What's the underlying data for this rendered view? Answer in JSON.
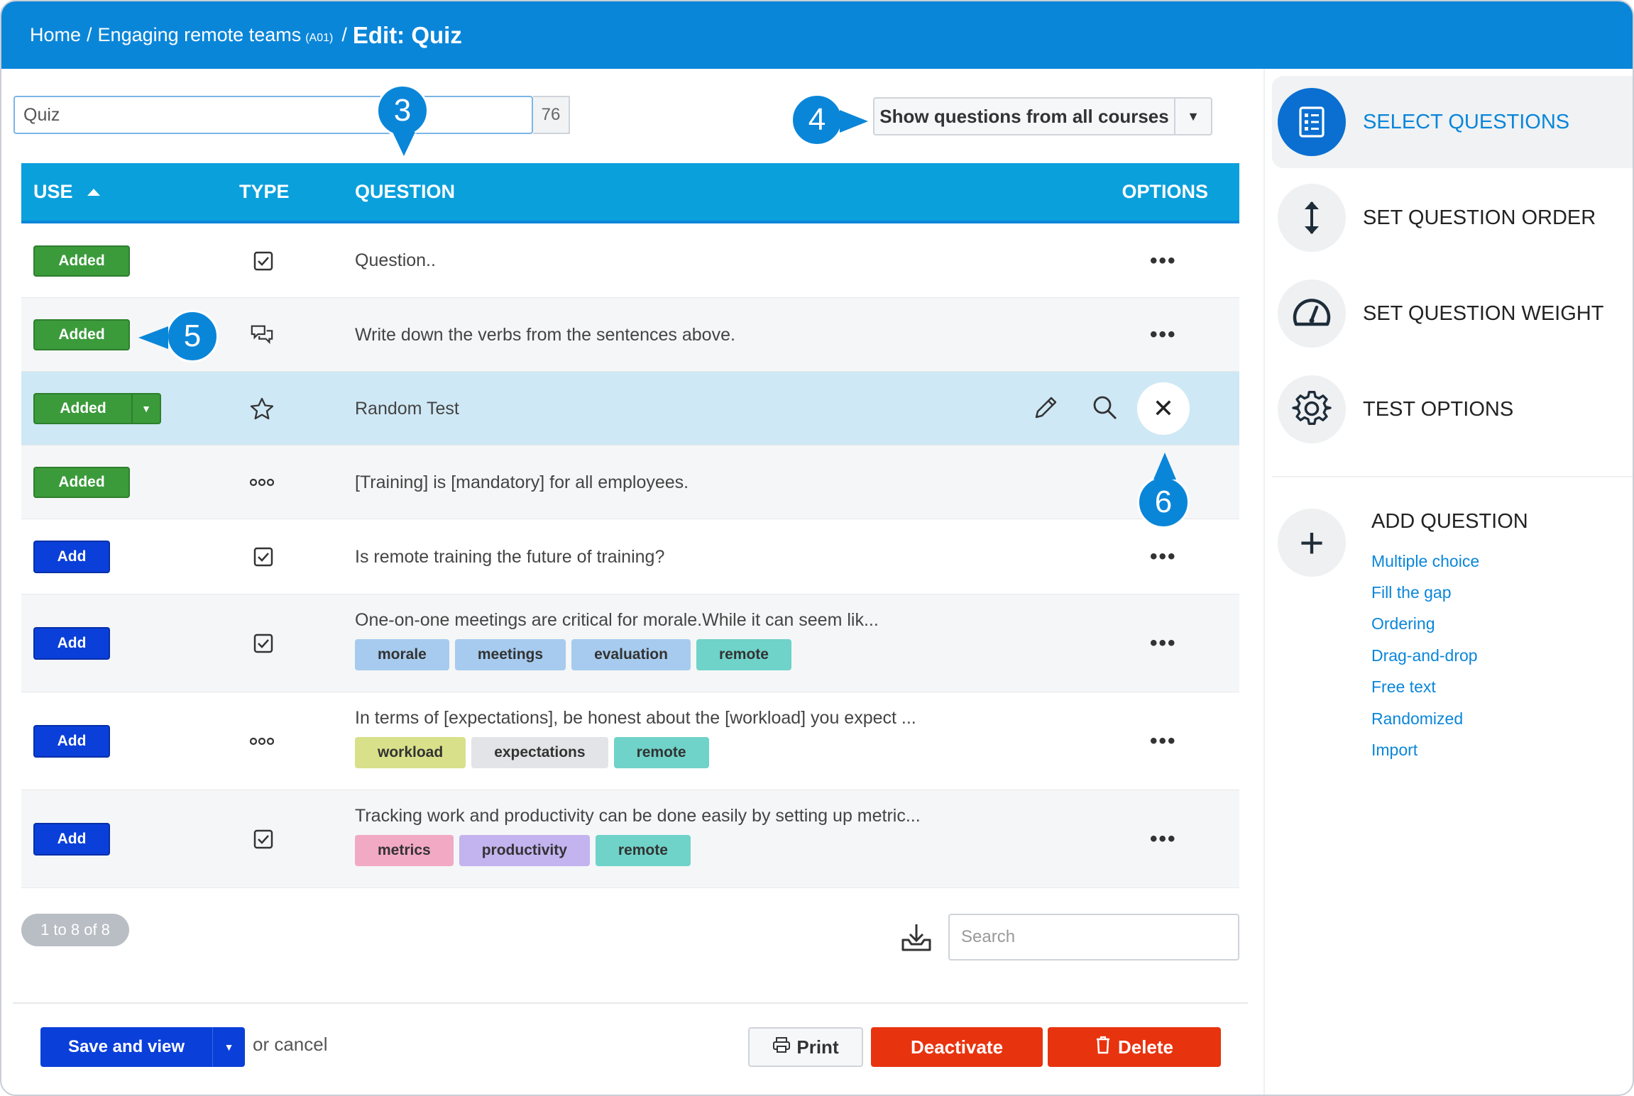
{
  "breadcrumb": {
    "home": "Home",
    "course": "Engaging remote teams",
    "course_code": "(A01)",
    "current": "Edit: Quiz"
  },
  "quiz": {
    "title_value": "Quiz",
    "char_count": "76"
  },
  "filter": {
    "label": "Show questions from all courses"
  },
  "callouts": {
    "c3": "3",
    "c4": "4",
    "c5": "5",
    "c6": "6"
  },
  "table": {
    "headers": {
      "use": "USE",
      "type": "TYPE",
      "question": "QUESTION",
      "options": "OPTIONS"
    },
    "rows": [
      {
        "use": "Added",
        "type_icon": "checkbox-icon",
        "question": "Question..",
        "tags": []
      },
      {
        "use": "Added",
        "type_icon": "chat-bubbles-icon",
        "question": "Write down the verbs from the sentences above.",
        "tags": []
      },
      {
        "use": "Added",
        "type_icon": "star-icon",
        "question": "Random Test",
        "tags": []
      },
      {
        "use": "Added",
        "type_icon": "fill-gap-icon",
        "question": "[Training] is [mandatory] for all employees.",
        "tags": []
      },
      {
        "use": "Add",
        "type_icon": "checkbox-icon",
        "question": "Is remote training the future of training?",
        "tags": []
      },
      {
        "use": "Add",
        "type_icon": "checkbox-icon",
        "question": "One-on-one meetings are critical for morale.While it can seem lik...",
        "tags": [
          "morale",
          "meetings",
          "evaluation",
          "remote"
        ]
      },
      {
        "use": "Add",
        "type_icon": "fill-gap-icon",
        "question": "In terms of [expectations], be honest about the [workload] you expect ...",
        "tags": [
          "workload",
          "expectations",
          "remote"
        ]
      },
      {
        "use": "Add",
        "type_icon": "checkbox-icon",
        "question": "Tracking work and productivity can be done easily by setting up metric...",
        "tags": [
          "metrics",
          "productivity",
          "remote"
        ]
      }
    ],
    "tag_colors": {
      "morale": "#a6cbee",
      "meetings": "#a6cbee",
      "evaluation": "#a6cbee",
      "remote": "#6fd3c9",
      "workload": "#d8e08a",
      "expectations": "#e2e4e7",
      "metrics": "#f2a9c4",
      "productivity": "#c3b3ef"
    }
  },
  "pager": {
    "label": "1 to 8 of 8"
  },
  "search": {
    "placeholder": "Search"
  },
  "footer": {
    "save_label": "Save and view",
    "cancel_text": "or cancel",
    "print_label": "Print",
    "deactivate_label": "Deactivate",
    "delete_label": "Delete"
  },
  "sidebar": {
    "items": [
      {
        "label": "SELECT QUESTIONS",
        "icon": "list-icon",
        "active": true
      },
      {
        "label": "SET QUESTION ORDER",
        "icon": "vertical-arrows-icon",
        "active": false
      },
      {
        "label": "SET QUESTION WEIGHT",
        "icon": "gauge-icon",
        "active": false
      },
      {
        "label": "TEST OPTIONS",
        "icon": "gear-icon",
        "active": false
      }
    ],
    "add_question": {
      "title": "ADD QUESTION",
      "links": [
        "Multiple choice",
        "Fill the gap",
        "Ordering",
        "Drag-and-drop",
        "Free text",
        "Randomized",
        "Import"
      ]
    }
  },
  "colors": {
    "header_blue": "#0a86d9",
    "table_head": "#0aa0dc",
    "added_green": "#3b9b3b",
    "add_blue": "#0a3fd9",
    "danger_red": "#e8330f"
  }
}
